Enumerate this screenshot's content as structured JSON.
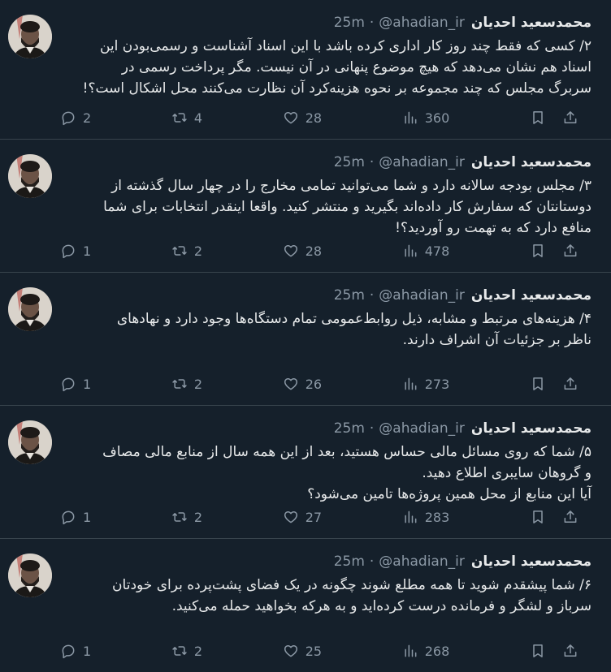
{
  "tweets": [
    {
      "name": "محمدسعید احدیان",
      "handle": "@ahadian_ir",
      "separator": "·",
      "time": "25m",
      "lines": [
        "۲/ کسی که فقط چند روز کار اداری کرده باشد با این اسناد آشناست و رسمی‌بودن این",
        "اسناد هم نشان می‌دهد که هیچ موضوع پنهانی در آن نیست.  مگر پرداخت رسمی در",
        "سربرگ مجلس که چند مجموعه بر نحوه هزینه‌کرد آن نظارت می‌کنند محل اشکال است؟!"
      ],
      "replies": "2",
      "reposts": "4",
      "likes": "28",
      "views": "360"
    },
    {
      "name": "محمدسعید احدیان",
      "handle": "@ahadian_ir",
      "separator": "·",
      "time": "25m",
      "lines": [
        "۳/ مجلس بودجه سالانه دارد و شما می‌توانید تمامی مخارج را در چهار سال گذشته از",
        "دوستانتان که سفارش کار داده‌اند بگیرید و منتشر کنید. واقعا اینقدر انتخابات برای شما",
        "منافع دارد که به تهمت رو آوردید؟!"
      ],
      "replies": "1",
      "reposts": "2",
      "likes": "28",
      "views": "478"
    },
    {
      "name": "محمدسعید احدیان",
      "handle": "@ahadian_ir",
      "separator": "·",
      "time": "25m",
      "lines": [
        "۴/ هزینه‌های مرتبط و مشابه، ذیل روابط‌عمومی تمام دستگاه‌ها وجود دارد و نهادهای",
        "ناظر بر جزئیات آن اشراف دارند."
      ],
      "replies": "1",
      "reposts": "2",
      "likes": "26",
      "views": "273"
    },
    {
      "name": "محمدسعید احدیان",
      "handle": "@ahadian_ir",
      "separator": "·",
      "time": "25m",
      "lines": [
        "۵/ شما که روی مسائل مالی حساس هستید، بعد از این همه سال از منابع مالی مصاف",
        "و گروهان سایبری اطلاع دهید.",
        "آیا این منابع از محل همین پروژه‌ها تامین می‌شود؟"
      ],
      "replies": "1",
      "reposts": "2",
      "likes": "27",
      "views": "283"
    },
    {
      "name": "محمدسعید احدیان",
      "handle": "@ahadian_ir",
      "separator": "·",
      "time": "25m",
      "lines": [
        "۶/ شما پیشقدم شوید تا همه مطلع شوند چگونه در یک فضای پشت‌پرده برای خودتان",
        "سرباز و لشگر و فرمانده درست کرده‌اید و به هرکه بخواهید حمله می‌کنید."
      ],
      "replies": "1",
      "reposts": "2",
      "likes": "25",
      "views": "268"
    }
  ],
  "icons": {
    "reply": "reply-icon",
    "repost": "repost-icon",
    "like": "like-icon",
    "views": "views-icon",
    "bookmark": "bookmark-icon",
    "share": "share-icon"
  },
  "colors": {
    "background": "#15202b",
    "text": "#e7e9ea",
    "muted": "#8b98a5",
    "divider": "#38444d"
  }
}
